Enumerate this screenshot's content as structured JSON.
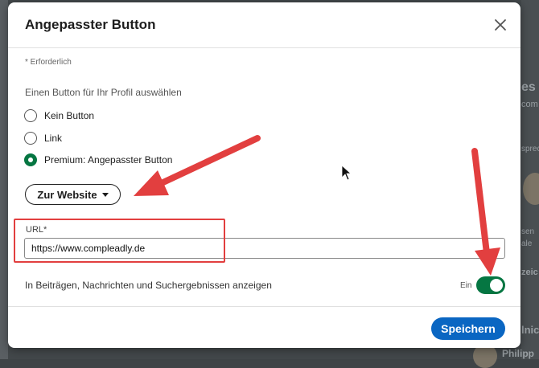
{
  "background": {
    "fragments": [
      "es I",
      "com",
      "sprec",
      "sen",
      "ale",
      "zeic",
      "lnic",
      "Philipp"
    ]
  },
  "modal": {
    "title": "Angepasster Button",
    "required_note": "* Erforderlich",
    "section_label": "Einen Button für Ihr Profil auswählen",
    "radio_options": [
      {
        "label": "Kein Button",
        "checked": false
      },
      {
        "label": "Link",
        "checked": false
      },
      {
        "label": "Premium: Angepasster Button",
        "checked": true
      }
    ],
    "dropdown": {
      "selected": "Zur Website"
    },
    "url_field": {
      "label": "URL*",
      "value": "https://www.compleadly.de"
    },
    "visibility_toggle": {
      "label": "In Beiträgen, Nachrichten und Suchergebnissen anzeigen",
      "state_text": "Ein",
      "on": true
    },
    "save_label": "Speichern"
  },
  "colors": {
    "accent_green": "#057642",
    "primary_blue": "#0a66c2",
    "annotation_red": "#e23f3f"
  },
  "icons": {
    "close": "close-icon",
    "caret": "chevron-down-icon",
    "cursor": "mouse-pointer-icon"
  }
}
